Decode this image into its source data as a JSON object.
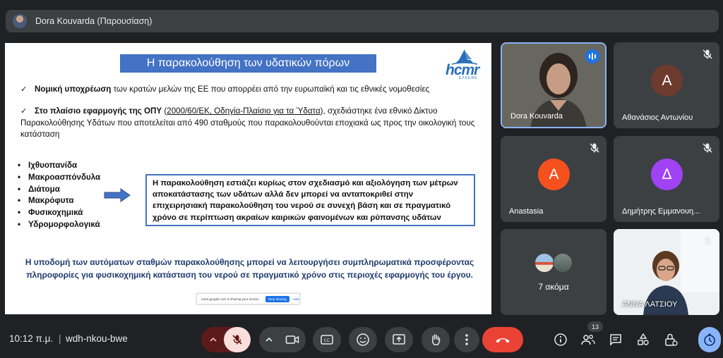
{
  "topbar": {
    "title": "Dora Kouvarda (Παρουσίαση)"
  },
  "slide": {
    "title": "Η παρακολούθηση των υδατικών πόρων",
    "logo": {
      "text": "hcmr",
      "sub": "ΕΛΚΕΘΕ"
    },
    "bullet1": {
      "bold": "Νομική υποχρέωση",
      "rest": " των κρατών μελών της ΕΕ που απορρέει από την ευρωπαϊκή και τις εθνικές νομοθεσίες"
    },
    "bullet2": {
      "bold": "Στο πλαίσιο εφαρμογής της ΟΠΥ",
      "paren_open": " (",
      "link": "2000/60/ΕΚ, Οδηγία-Πλαίσιο για τα Ύδατα",
      "rest": "), σχεδιάστηκε ένα εθνικό Δίκτυο Παρακολούθησης Υδάτων που αποτελείται από 490 σταθμούς που παρακολουθούνται εποχιακά ως προς την οικολογική τους κατάσταση"
    },
    "list": [
      "Ιχθυοπανίδα",
      "Μακροασπόνδυλα",
      "Διάτομα",
      "Μακρόφυτα",
      "Φυσικοχημικά",
      "Υδρομορφολογικά"
    ],
    "box": "Η παρακολούθηση εστιάζει κυρίως στον σχεδιασμό και αξιολόγηση των μέτρων αποκατάστασης των υδάτων αλλά δεν μπορεί να ανταποκριθεί στην επιχειρησιακή παρακολούθηση του νερού σε συνεχή βάση και σε πραγματικό χρόνο σε περίπτωση ακραίων καιρικών φαινομένων και ρύπανσης υδάτων",
    "conclusion": "Η υποδομή των αυτόματων σταθμών παρακολούθησης μπορεί να λειτουργήσει συμπληρωματικά προσφέροντας πληροφορίες για φυσικοχημική κατάσταση του νερού  σε πραγματικό χρόνο στις περιοχές εφαρμογής του έργου.",
    "sharebar": {
      "text": "meet.google.com is sharing your screen.",
      "stop": "Stop sharing",
      "hide": "Hide"
    }
  },
  "tiles": [
    {
      "name": "Dora Kouvarda",
      "type": "video",
      "speaking": true
    },
    {
      "name": "Αθανάσιος Αντωνίου",
      "initial": "Α",
      "color": "#6d3a2e",
      "muted": true
    },
    {
      "name": "Anastasia",
      "initial": "A",
      "color": "#f4511e",
      "muted": true
    },
    {
      "name": "Δημήτρης Εμμανουη...",
      "initial": "Δ",
      "color": "#a142f4",
      "muted": true
    },
    {
      "more": "7 ακόμα"
    },
    {
      "name": "ΑΝΝΑ ΛΑΤΣΙΟΥ",
      "type": "video",
      "muted": true
    }
  ],
  "bottom": {
    "time": "10:12 π.μ.",
    "separator": "|",
    "meeting_code": "wdh-nkou-bwe",
    "participants_count": "13"
  },
  "icons": {
    "mic": "mic-off-icon",
    "camera": "videocam-icon",
    "captions": "closed-caption-icon",
    "emoji": "emoji-icon",
    "present": "present-screen-icon",
    "hand": "raise-hand-icon",
    "more": "more-vert-icon",
    "end": "call-end-icon",
    "info": "info-icon",
    "people": "people-icon",
    "chat": "chat-icon",
    "activities": "activities-icon",
    "host": "host-controls-icon",
    "timer": "timer-icon"
  }
}
